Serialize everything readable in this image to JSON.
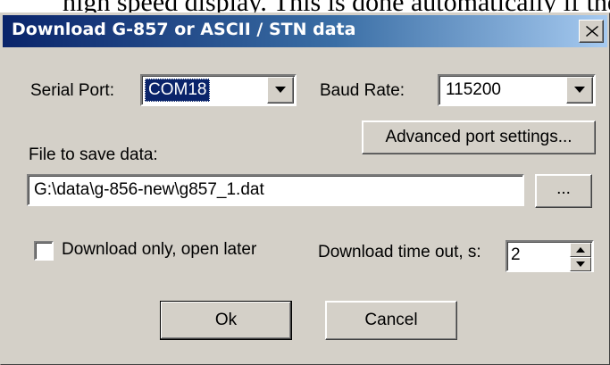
{
  "background": {
    "partial_text": "high speed display. This is done automatically if the"
  },
  "dialog": {
    "title": "Download G-857 or ASCII / STN data",
    "close_label": "×"
  },
  "serial_port": {
    "label": "Serial Port:",
    "value": "COM18"
  },
  "baud_rate": {
    "label": "Baud Rate:",
    "value": "115200"
  },
  "advanced_button": {
    "label": "Advanced port settings..."
  },
  "file": {
    "label": "File to save data:",
    "path": "G:\\data\\g-856-new\\g857_1.dat",
    "browse_label": "..."
  },
  "download_only": {
    "label": "Download only, open later",
    "checked": false
  },
  "timeout": {
    "label": "Download time out, s:",
    "value": "2"
  },
  "buttons": {
    "ok": "Ok",
    "cancel": "Cancel"
  },
  "colors": {
    "face": "#d4d0c8",
    "title_start": "#0a246a",
    "title_end": "#a6caf0",
    "selection": "#0a246a"
  }
}
